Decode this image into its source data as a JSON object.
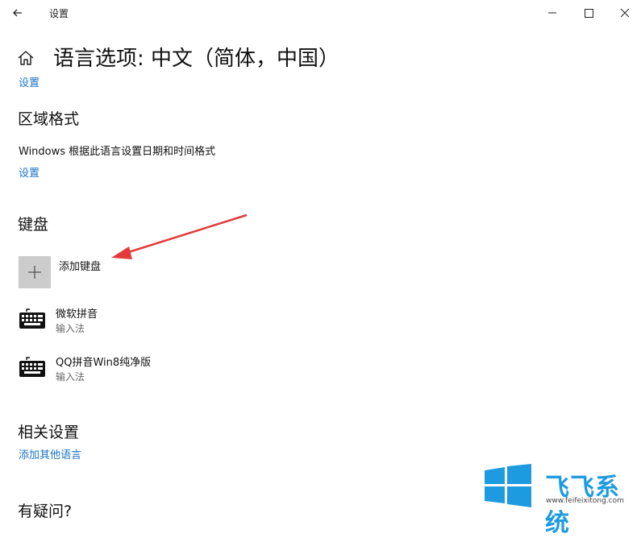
{
  "window": {
    "title": "设置",
    "back_icon": "arrow-left-icon",
    "minimize_icon": "minimize-icon",
    "maximize_icon": "maximize-icon",
    "close_icon": "close-icon"
  },
  "header": {
    "home_icon": "home-icon",
    "page_title": "语言选项: 中文（简体，中国）",
    "top_link": "设置"
  },
  "region": {
    "heading": "区域格式",
    "description": "Windows 根据此语言设置日期和时间格式",
    "link": "设置"
  },
  "keyboards": {
    "heading": "键盘",
    "add_label": "添加键盘",
    "add_icon": "plus-icon",
    "items": [
      {
        "name": "微软拼音",
        "sub": "输入法",
        "icon": "keyboard-icon"
      },
      {
        "name": "QQ拼音Win8纯净版",
        "sub": "输入法",
        "icon": "keyboard-icon"
      }
    ]
  },
  "related": {
    "heading": "相关设置",
    "link": "添加其他语言"
  },
  "cutoff_heading": "有疑问?",
  "watermark": {
    "brand": "飞飞系统",
    "url": "www.feifeixitong.com"
  },
  "colors": {
    "accent": "#1a73c8",
    "arrow": "#e23b3b",
    "logo": "#1e9be0"
  }
}
